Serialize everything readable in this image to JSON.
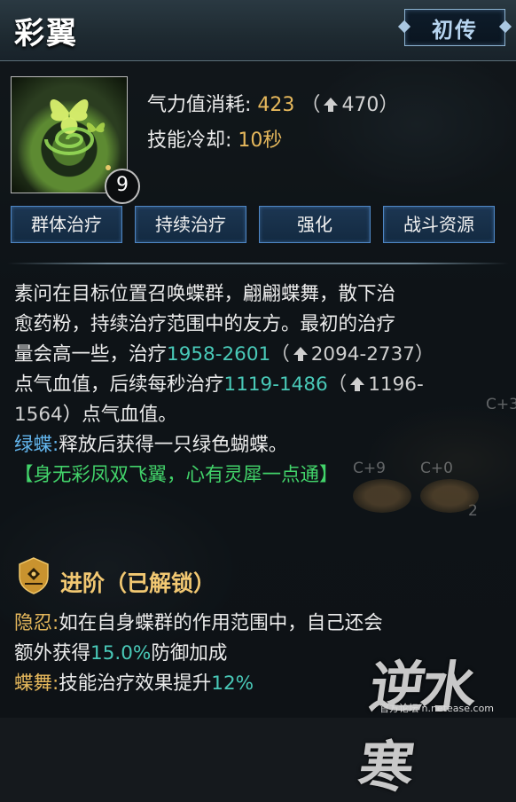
{
  "header": {
    "title": "彩翼",
    "rank": "初传"
  },
  "skill": {
    "level": "9",
    "cost_label": "气力值消耗:",
    "cost_value": "423",
    "cost_open": "（",
    "cost_upgrade": "470",
    "cost_close": "）",
    "cooldown_label": "技能冷却:",
    "cooldown_value": "10秒"
  },
  "tags": [
    "群体治疗",
    "持续治疗",
    "强化",
    "战斗资源"
  ],
  "description": {
    "line1": "素问在目标位置召唤蝶群，翩翩蝶舞，散下治",
    "line2": "愈药粉，持续治疗范围中的友方。最初的治疗",
    "line3_a": "量会高一些，治疗",
    "line3_b": "1958-2601",
    "line3_c": "（",
    "line3_d": "2094-2737",
    "line3_e": "）",
    "line4_a": "点气血值，后续每秒治疗",
    "line4_b": "1119-1486",
    "line4_c": "（",
    "line4_d": "1196-",
    "line5_a": "1564",
    "line5_b": "）点气血值。",
    "green_label": "绿蝶:",
    "green_text": "释放后获得一只绿色蝴蝶。",
    "quote": "【身无彩凤双飞翼，心有灵犀一点通】"
  },
  "advance": {
    "title": "进阶（已解锁）",
    "line1_label": "隐忍:",
    "line1_text": "如在自身蝶群的作用范围中，自己还会",
    "line2_a": "额外获得",
    "line2_b": "15.0%",
    "line2_c": "防御加成",
    "line3_label": "蝶舞:",
    "line3_text": "技能治疗效果提升",
    "line3_value": "12%"
  },
  "background": {
    "num1": "C+9",
    "num2": "C+0",
    "num3": "2",
    "num4": "C+3"
  },
  "watermark": {
    "logo": "逆水寒",
    "text": "官方论坛 n.netease.com"
  },
  "colors": {
    "gold": "#e6b85c",
    "teal": "#49c9b8",
    "tag_border": "#4e86c4",
    "label_blue": "#63b6ee",
    "quote_green": "#42d36a"
  }
}
